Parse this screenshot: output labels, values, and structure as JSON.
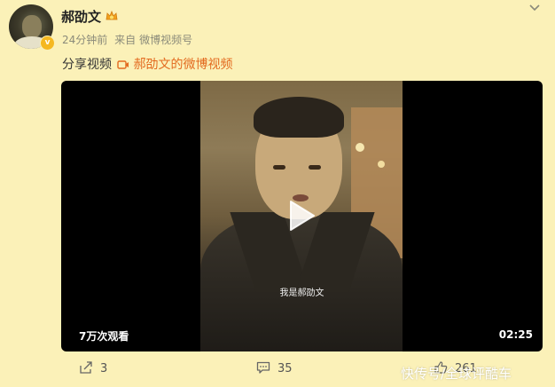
{
  "post": {
    "username": "郝劭文",
    "time": "24分钟前",
    "source_prefix": "来自",
    "source": "微博视频号",
    "text": "分享视频",
    "link_text": "郝劭文的微博视频"
  },
  "video": {
    "subtitle": "我是郝劭文",
    "views": "7万次观看",
    "duration": "02:25"
  },
  "actions": {
    "share_count": "3",
    "comment_count": "35",
    "like_count": "261"
  },
  "watermark": "快传号/全球评酷车",
  "icons": {
    "verified": "verified-badge-icon",
    "vip": "vip-crown-icon",
    "menu": "chevron-down-icon",
    "video_link": "video-link-icon",
    "play": "play-icon",
    "share": "share-icon",
    "comment": "comment-icon",
    "like": "like-icon"
  },
  "colors": {
    "background": "#fbf1b8",
    "link": "#e36a1f",
    "badge": "#f5b820"
  }
}
